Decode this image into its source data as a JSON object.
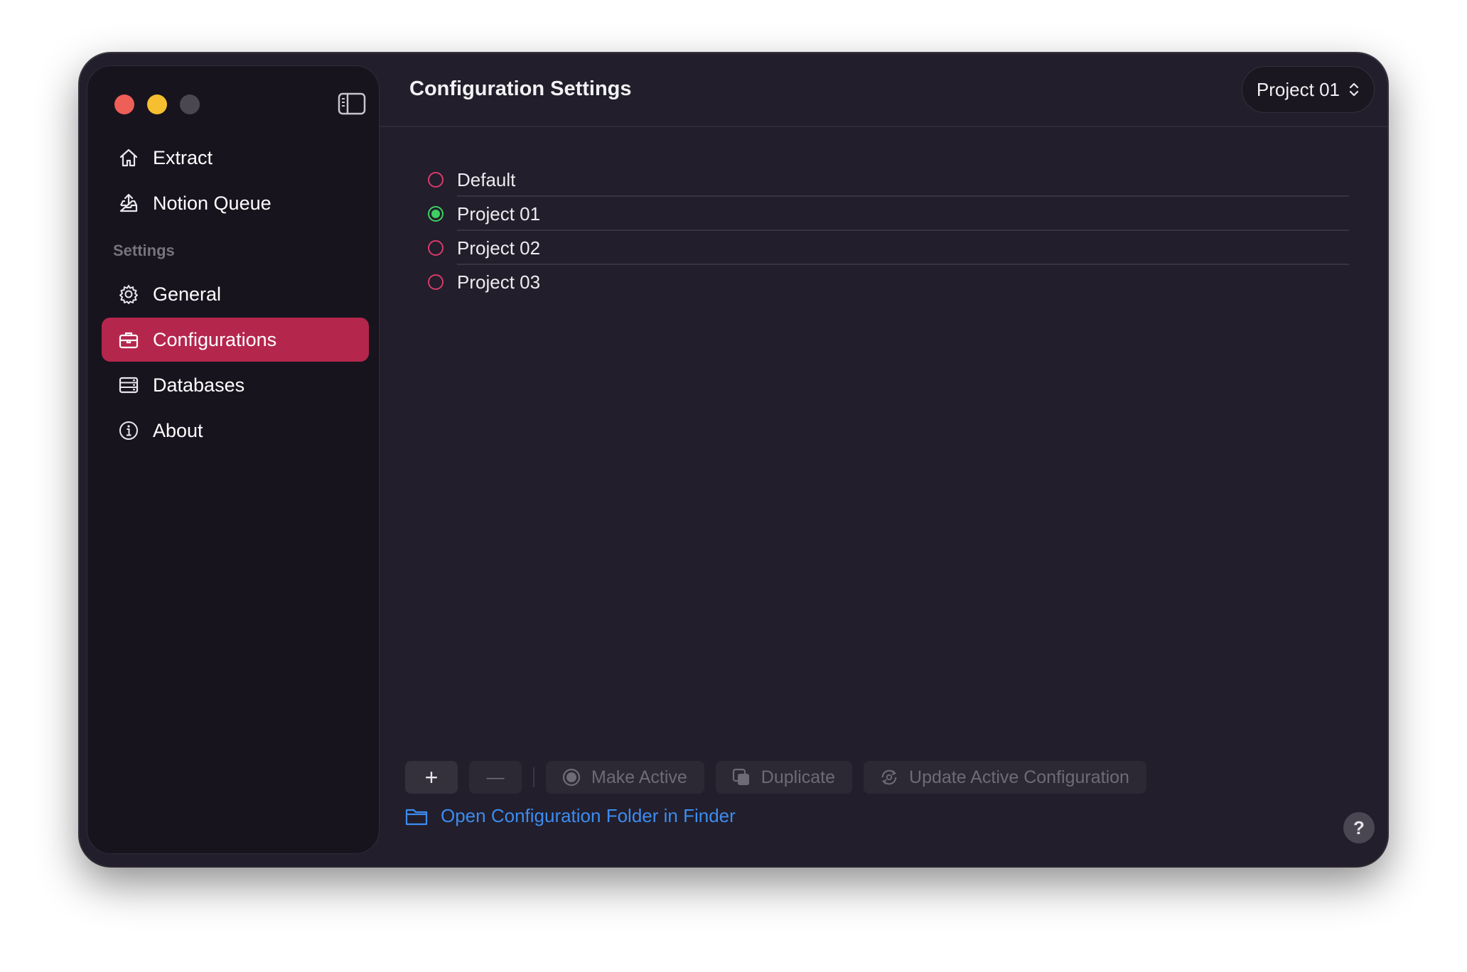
{
  "window": {
    "controls": [
      "close",
      "minimize",
      "zoom"
    ]
  },
  "sidebar": {
    "toggle_icon": "sidebar-toggle-icon",
    "items": [
      {
        "label": "Extract",
        "icon": "home-icon"
      },
      {
        "label": "Notion Queue",
        "icon": "upload-tray-icon"
      }
    ],
    "section_label": "Settings",
    "settings_items": [
      {
        "label": "General",
        "icon": "gear-icon"
      },
      {
        "label": "Configurations",
        "icon": "briefcase-icon",
        "active": true
      },
      {
        "label": "Databases",
        "icon": "database-icon"
      },
      {
        "label": "About",
        "icon": "info-icon"
      }
    ]
  },
  "header": {
    "title": "Configuration Settings",
    "project_select": "Project 01"
  },
  "configurations": [
    {
      "label": "Default",
      "active": false
    },
    {
      "label": "Project 01",
      "active": true
    },
    {
      "label": "Project 02",
      "active": false
    },
    {
      "label": "Project 03",
      "active": false
    }
  ],
  "toolbar": {
    "add_label": "+",
    "remove_label": "—",
    "make_active_label": "Make Active",
    "duplicate_label": "Duplicate",
    "update_label": "Update Active Configuration"
  },
  "footer": {
    "finder_link": "Open Configuration Folder in Finder",
    "help_label": "?"
  },
  "colors": {
    "accent": "#b5264d",
    "active_radio": "#3fcf63",
    "inactive_radio": "#d73b6b",
    "link": "#3c8cf0",
    "window_bg": "#221e2b",
    "sidebar_bg": "#17141e"
  }
}
